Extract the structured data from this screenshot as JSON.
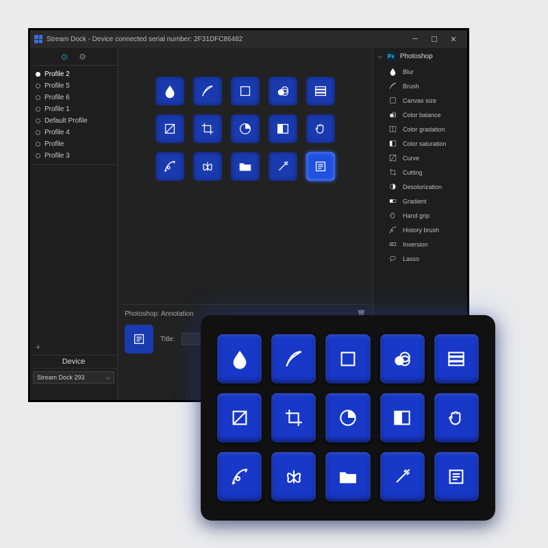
{
  "titlebar": {
    "text": "Stream Dock - Device connected serial number: 2F31DFC86482"
  },
  "sidebar": {
    "profiles": [
      {
        "label": "Profile 2",
        "selected": true
      },
      {
        "label": "Profile 5",
        "selected": false
      },
      {
        "label": "Profile 6",
        "selected": false
      },
      {
        "label": "Profile 1",
        "selected": false
      },
      {
        "label": "Default Profile",
        "selected": false
      },
      {
        "label": "Profile 4",
        "selected": false
      },
      {
        "label": "Profile",
        "selected": false
      },
      {
        "label": "Profile 3",
        "selected": false
      }
    ],
    "device_header": "Device",
    "device_selected": "Stream Dock 293"
  },
  "grid": {
    "keys": [
      "blur",
      "brush",
      "canvas",
      "colorbalance",
      "filter",
      "crop-diag",
      "crop",
      "pie",
      "split",
      "hand",
      "history",
      "butterfly",
      "folder",
      "wand",
      "annotation"
    ],
    "highlighted": 14
  },
  "editor": {
    "breadcrumb": "Photoshop: Annotation",
    "title_label": "Title:",
    "title_value": ""
  },
  "rightpane": {
    "header": "Photoshop",
    "items": [
      {
        "icon": "blur",
        "label": "Blur"
      },
      {
        "icon": "brush",
        "label": "Brush"
      },
      {
        "icon": "canvas",
        "label": "Canvas size"
      },
      {
        "icon": "colorbalance",
        "label": "Color balance"
      },
      {
        "icon": "gradation",
        "label": "Color gradation"
      },
      {
        "icon": "saturation",
        "label": "Color saturation"
      },
      {
        "icon": "curve",
        "label": "Curve"
      },
      {
        "icon": "crop",
        "label": "Cutting"
      },
      {
        "icon": "desat",
        "label": "Desolorization"
      },
      {
        "icon": "gradient",
        "label": "Gradient"
      },
      {
        "icon": "hand",
        "label": "Hand grip"
      },
      {
        "icon": "history",
        "label": "History brush"
      },
      {
        "icon": "inversion",
        "label": "Inversion"
      },
      {
        "icon": "lasso",
        "label": "Lasso"
      }
    ]
  }
}
